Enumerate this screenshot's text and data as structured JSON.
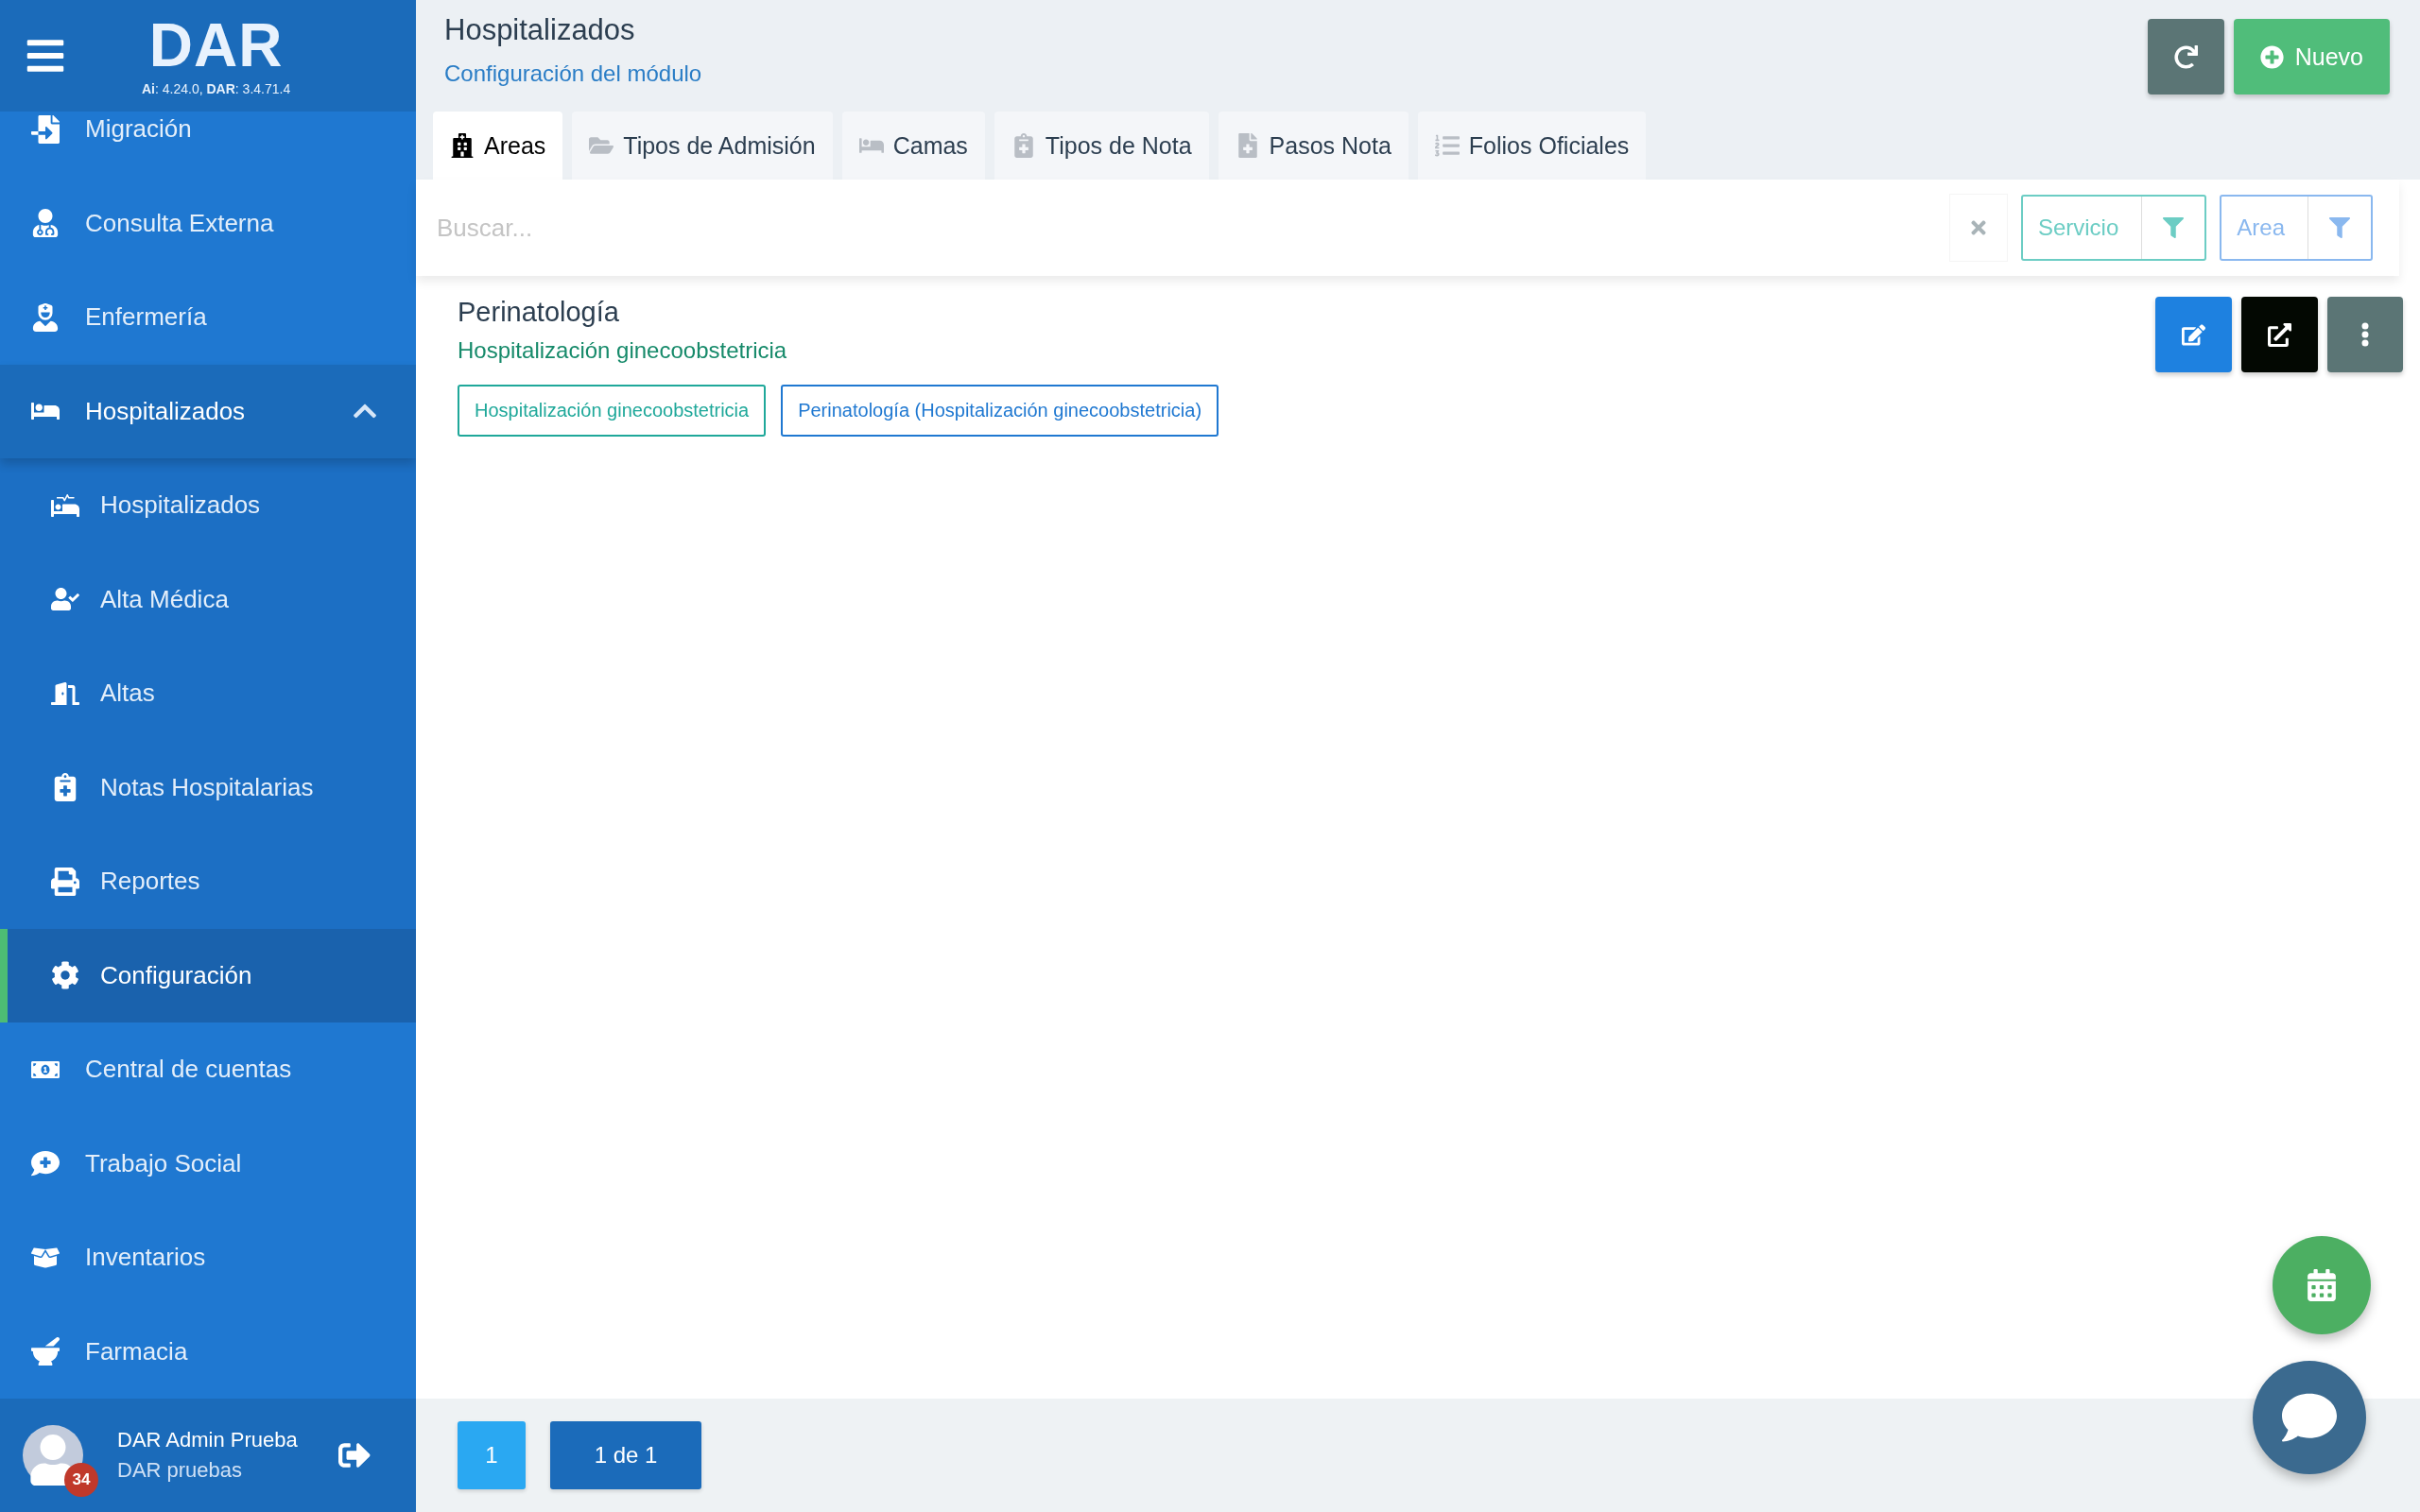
{
  "sidebar": {
    "logo": "DAR",
    "version": "**Ai**: 4.24.0, **DAR**: 3.4.71.4",
    "items": [
      {
        "label": "Migración",
        "selected": false
      },
      {
        "label": "Consulta Externa",
        "selected": false
      },
      {
        "label": "Enfermería",
        "selected": false
      },
      {
        "label": "Hospitalizados",
        "selected": false,
        "expanded": true,
        "children": [
          {
            "label": "Hospitalizados",
            "selected": false
          },
          {
            "label": "Alta Médica",
            "selected": false
          },
          {
            "label": "Altas",
            "selected": false
          },
          {
            "label": "Notas Hospitalarias",
            "selected": false
          },
          {
            "label": "Reportes",
            "selected": false
          },
          {
            "label": "Configuración",
            "selected": true
          }
        ]
      },
      {
        "label": "Central de cuentas",
        "selected": false
      },
      {
        "label": "Trabajo Social",
        "selected": false
      },
      {
        "label": "Inventarios",
        "selected": false
      },
      {
        "label": "Farmacia",
        "selected": false
      }
    ],
    "user": {
      "name": "DAR Admin Prueba",
      "org": "DAR pruebas",
      "badge": "34"
    }
  },
  "header": {
    "title": "Hospitalizados",
    "subtitle": "Configuración del módulo",
    "new_button": "Nuevo"
  },
  "tabs": [
    {
      "label": "Areas",
      "selected": true
    },
    {
      "label": "Tipos de Admisión",
      "selected": false
    },
    {
      "label": "Camas",
      "selected": false
    },
    {
      "label": "Tipos de Nota",
      "selected": false
    },
    {
      "label": "Pasos Nota",
      "selected": false
    },
    {
      "label": "Folios Oficiales",
      "selected": false
    }
  ],
  "search": {
    "placeholder": "Buscar...",
    "filters": [
      {
        "label": "Servicio",
        "color": "#6ccdc4"
      },
      {
        "label": "Area",
        "color": "#8ab8ef"
      }
    ]
  },
  "records": [
    {
      "title": "Perinatología",
      "subtitle": "Hospitalización ginecoobstetricia",
      "tags": [
        {
          "label": "Hospitalización ginecoobstetricia",
          "color": "#1fa89a"
        },
        {
          "label": "Perinatología (Hospitalización ginecoobstetricia)",
          "color": "#1f78d1"
        }
      ]
    }
  ],
  "pagination": {
    "pages": [
      {
        "label": "1",
        "selected": true
      }
    ],
    "summary": "1 de 1"
  }
}
